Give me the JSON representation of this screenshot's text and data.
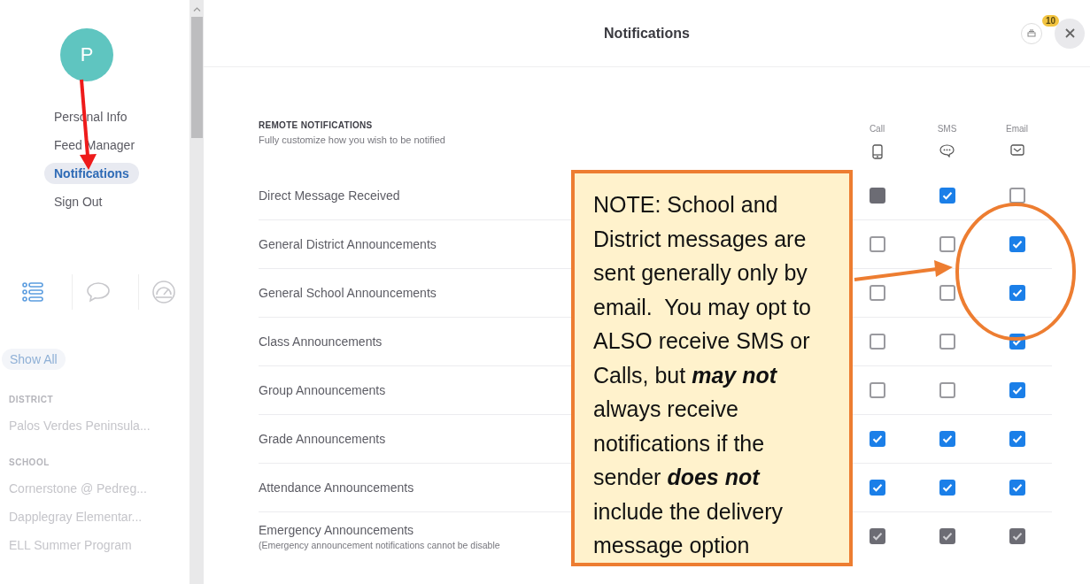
{
  "sidebar": {
    "avatar": "P",
    "menu": [
      {
        "label": "Personal Info",
        "selected": false
      },
      {
        "label": "Feed Manager",
        "selected": false
      },
      {
        "label": "Notifications",
        "selected": true
      },
      {
        "label": "Sign Out",
        "selected": false
      }
    ],
    "view_tabs": [
      {
        "kind": "list",
        "selected": true
      },
      {
        "kind": "chat",
        "selected": false
      },
      {
        "kind": "gauge",
        "selected": false
      }
    ],
    "show_all": "Show All",
    "groups": [
      {
        "title": "DISTRICT",
        "items": [
          "Palos Verdes Peninsula..."
        ]
      },
      {
        "title": "SCHOOL",
        "items": [
          "Cornerstone @ Pedreg...",
          "Dapplegray Elementar...",
          "ELL Summer Program"
        ]
      }
    ]
  },
  "header": {
    "title": "Notifications",
    "badge": "10"
  },
  "section": {
    "title": "REMOTE NOTIFICATIONS",
    "subtitle": "Fully customize how you wish to be notified"
  },
  "columns": [
    {
      "label": "Call",
      "kind": "phone"
    },
    {
      "label": "SMS",
      "kind": "chat"
    },
    {
      "label": "Email",
      "kind": "envelope"
    }
  ],
  "rows": [
    {
      "label": "Direct Message Received",
      "options": [
        {
          "checked": false,
          "disabled": true
        },
        {
          "checked": true,
          "disabled": false
        },
        {
          "checked": false,
          "disabled": false
        }
      ]
    },
    {
      "label": "General District Announcements",
      "options": [
        {
          "checked": false,
          "disabled": false
        },
        {
          "checked": false,
          "disabled": false
        },
        {
          "checked": true,
          "disabled": false
        }
      ]
    },
    {
      "label": "General School Announcements",
      "options": [
        {
          "checked": false,
          "disabled": false
        },
        {
          "checked": false,
          "disabled": false
        },
        {
          "checked": true,
          "disabled": false
        }
      ]
    },
    {
      "label": "Class Announcements",
      "options": [
        {
          "checked": false,
          "disabled": false
        },
        {
          "checked": false,
          "disabled": false
        },
        {
          "checked": true,
          "disabled": false
        }
      ]
    },
    {
      "label": "Group Announcements",
      "options": [
        {
          "checked": false,
          "disabled": false
        },
        {
          "checked": false,
          "disabled": false
        },
        {
          "checked": true,
          "disabled": false
        }
      ]
    },
    {
      "label": "Grade Announcements",
      "options": [
        {
          "checked": true,
          "disabled": false
        },
        {
          "checked": true,
          "disabled": false
        },
        {
          "checked": true,
          "disabled": false
        }
      ]
    },
    {
      "label": "Attendance Announcements",
      "options": [
        {
          "checked": true,
          "disabled": false
        },
        {
          "checked": true,
          "disabled": false
        },
        {
          "checked": true,
          "disabled": false
        }
      ]
    },
    {
      "label": "Emergency Announcements",
      "note": "(Emergency announcement notifications cannot be disable",
      "options": [
        {
          "checked": true,
          "disabled": true
        },
        {
          "checked": true,
          "disabled": true
        },
        {
          "checked": true,
          "disabled": true
        }
      ]
    }
  ],
  "annotation": {
    "text": "NOTE: School and District messages are sent generally only by email.  You may opt to ALSO receive SMS or Calls, but **may not** always receive notifications if the sender **does not** include the delivery message option"
  }
}
